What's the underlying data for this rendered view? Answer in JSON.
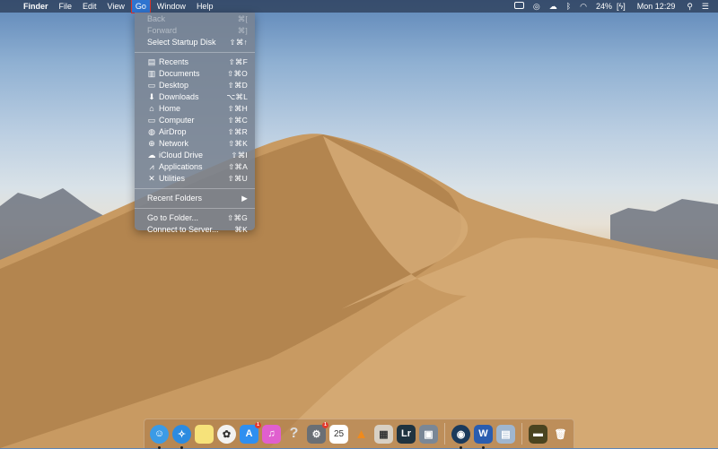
{
  "menubar": {
    "apple": "",
    "app_name": "Finder",
    "menus": [
      "File",
      "Edit",
      "View",
      "Go",
      "Window",
      "Help"
    ],
    "active_menu": "Go",
    "status": {
      "battery_percent": "24%",
      "clock": "Mon 12:29",
      "icons": [
        "display-icon",
        "creative-cloud-icon",
        "cloud-sync-icon",
        "bluetooth-icon",
        "wifi-icon",
        "battery-charging-icon",
        "spotlight-search-icon",
        "notification-center-icon"
      ]
    }
  },
  "go_menu": {
    "groups": [
      [
        {
          "label": "Back",
          "shortcut": "⌘[",
          "enabled": false,
          "icon": ""
        },
        {
          "label": "Forward",
          "shortcut": "⌘]",
          "enabled": false,
          "icon": ""
        },
        {
          "label": "Select Startup Disk",
          "shortcut": "⇧⌘↑",
          "enabled": true,
          "icon": ""
        }
      ],
      [
        {
          "label": "Recents",
          "shortcut": "⇧⌘F",
          "enabled": true,
          "icon": "recents-icon"
        },
        {
          "label": "Documents",
          "shortcut": "⇧⌘O",
          "enabled": true,
          "icon": "documents-icon"
        },
        {
          "label": "Desktop",
          "shortcut": "⇧⌘D",
          "enabled": true,
          "icon": "desktop-icon"
        },
        {
          "label": "Downloads",
          "shortcut": "⌥⌘L",
          "enabled": true,
          "icon": "downloads-icon"
        },
        {
          "label": "Home",
          "shortcut": "⇧⌘H",
          "enabled": true,
          "icon": "home-icon"
        },
        {
          "label": "Computer",
          "shortcut": "⇧⌘C",
          "enabled": true,
          "icon": "computer-icon"
        },
        {
          "label": "AirDrop",
          "shortcut": "⇧⌘R",
          "enabled": true,
          "icon": "airdrop-icon"
        },
        {
          "label": "Network",
          "shortcut": "⇧⌘K",
          "enabled": true,
          "icon": "network-icon"
        },
        {
          "label": "iCloud Drive",
          "shortcut": "⇧⌘I",
          "enabled": true,
          "icon": "icloud-icon"
        },
        {
          "label": "Applications",
          "shortcut": "⇧⌘A",
          "enabled": true,
          "icon": "applications-icon"
        },
        {
          "label": "Utilities",
          "shortcut": "⇧⌘U",
          "enabled": true,
          "icon": "utilities-icon"
        }
      ],
      [
        {
          "label": "Recent Folders",
          "shortcut": "▶",
          "enabled": true,
          "icon": ""
        }
      ],
      [
        {
          "label": "Go to Folder...",
          "shortcut": "⇧⌘G",
          "enabled": true,
          "icon": ""
        },
        {
          "label": "Connect to Server...",
          "shortcut": "⌘K",
          "enabled": true,
          "icon": ""
        }
      ]
    ]
  },
  "dock": {
    "apps": [
      {
        "name": "finder",
        "glyph": "☺",
        "color": "#3b9be6",
        "running": true
      },
      {
        "name": "safari",
        "glyph": "✧",
        "color": "#2c8be0",
        "running": true
      },
      {
        "name": "notes",
        "glyph": "",
        "color": "#f6e27a"
      },
      {
        "name": "photos",
        "glyph": "✿",
        "color": "#f2f2f2"
      },
      {
        "name": "app-store",
        "glyph": "A",
        "color": "#2f8ff0",
        "badge": "1"
      },
      {
        "name": "itunes",
        "glyph": "♫",
        "color": "#e05fcf"
      },
      {
        "name": "help",
        "glyph": "?",
        "color": "transparent"
      },
      {
        "name": "system-preferences",
        "glyph": "⚙",
        "color": "#6a6f75",
        "badge": "1"
      },
      {
        "name": "calendar",
        "glyph": "25",
        "color": "#ffffff"
      },
      {
        "name": "vlc",
        "glyph": "▲",
        "color": "transparent"
      },
      {
        "name": "calculator-doc",
        "glyph": "▦",
        "color": "#d8d0c4"
      },
      {
        "name": "lightroom",
        "glyph": "Lr",
        "color": "#1f3340"
      },
      {
        "name": "screen-capture",
        "glyph": "▣",
        "color": "#7a8796"
      },
      {
        "name": "steam",
        "glyph": "◉",
        "color": "#1b3a5c",
        "running": true,
        "sep_before": true
      },
      {
        "name": "word",
        "glyph": "W",
        "color": "#2a5db0",
        "running": true
      },
      {
        "name": "preview",
        "glyph": "▤",
        "color": "#9fb6cf"
      },
      {
        "name": "video-app",
        "glyph": "▬",
        "color": "#4a4420",
        "sep_before": true
      },
      {
        "name": "trash",
        "glyph": "🗑",
        "color": "transparent"
      }
    ]
  }
}
